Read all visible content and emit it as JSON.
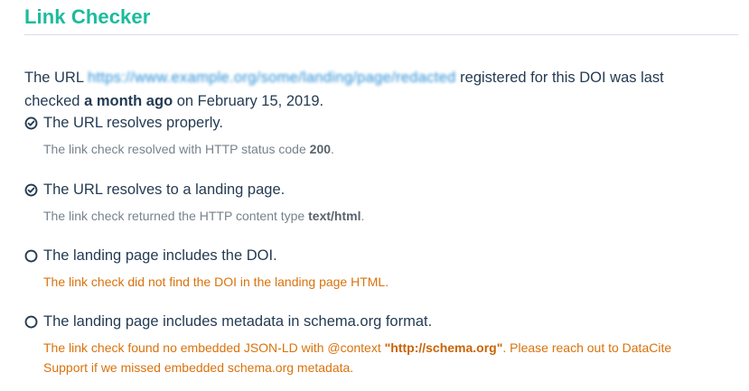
{
  "section": {
    "title": "Link Checker"
  },
  "intro": {
    "prefix": "The URL",
    "url": "https://www.example.org/some/landing/page/redacted",
    "middle": "registered for this DOI was last checked",
    "bold_ago": "a month ago",
    "suffix": "on February 15, 2019."
  },
  "checks": [
    {
      "status": "pass",
      "icon": "check-circle-icon",
      "title": "The URL resolves properly.",
      "detail_prefix": "The link check resolved with HTTP status code",
      "detail_bold": "200",
      "detail_suffix": "."
    },
    {
      "status": "pass",
      "icon": "check-circle-icon",
      "title": "The URL resolves to a landing page.",
      "detail_prefix": "The link check returned the HTTP content type",
      "detail_bold": "text/html",
      "detail_suffix": "."
    },
    {
      "status": "fail",
      "icon": "empty-circle-icon",
      "title": "The landing page includes the DOI.",
      "detail_prefix": "The link check did not find the DOI in the landing page HTML.",
      "detail_bold": "",
      "detail_suffix": ""
    },
    {
      "status": "fail",
      "icon": "empty-circle-icon",
      "title": "The landing page includes metadata in schema.org format.",
      "detail_prefix": "The link check found no embedded JSON-LD with @context",
      "detail_bold": "\"http://schema.org\"",
      "detail_suffix": ". Please reach out to DataCite Support if we missed embedded schema.org metadata."
    }
  ],
  "colors": {
    "title_accent": "#1abc9c",
    "link": "#2a8fd6",
    "text": "#243b53",
    "muted": "#77828c",
    "warning": "#d9720c"
  }
}
